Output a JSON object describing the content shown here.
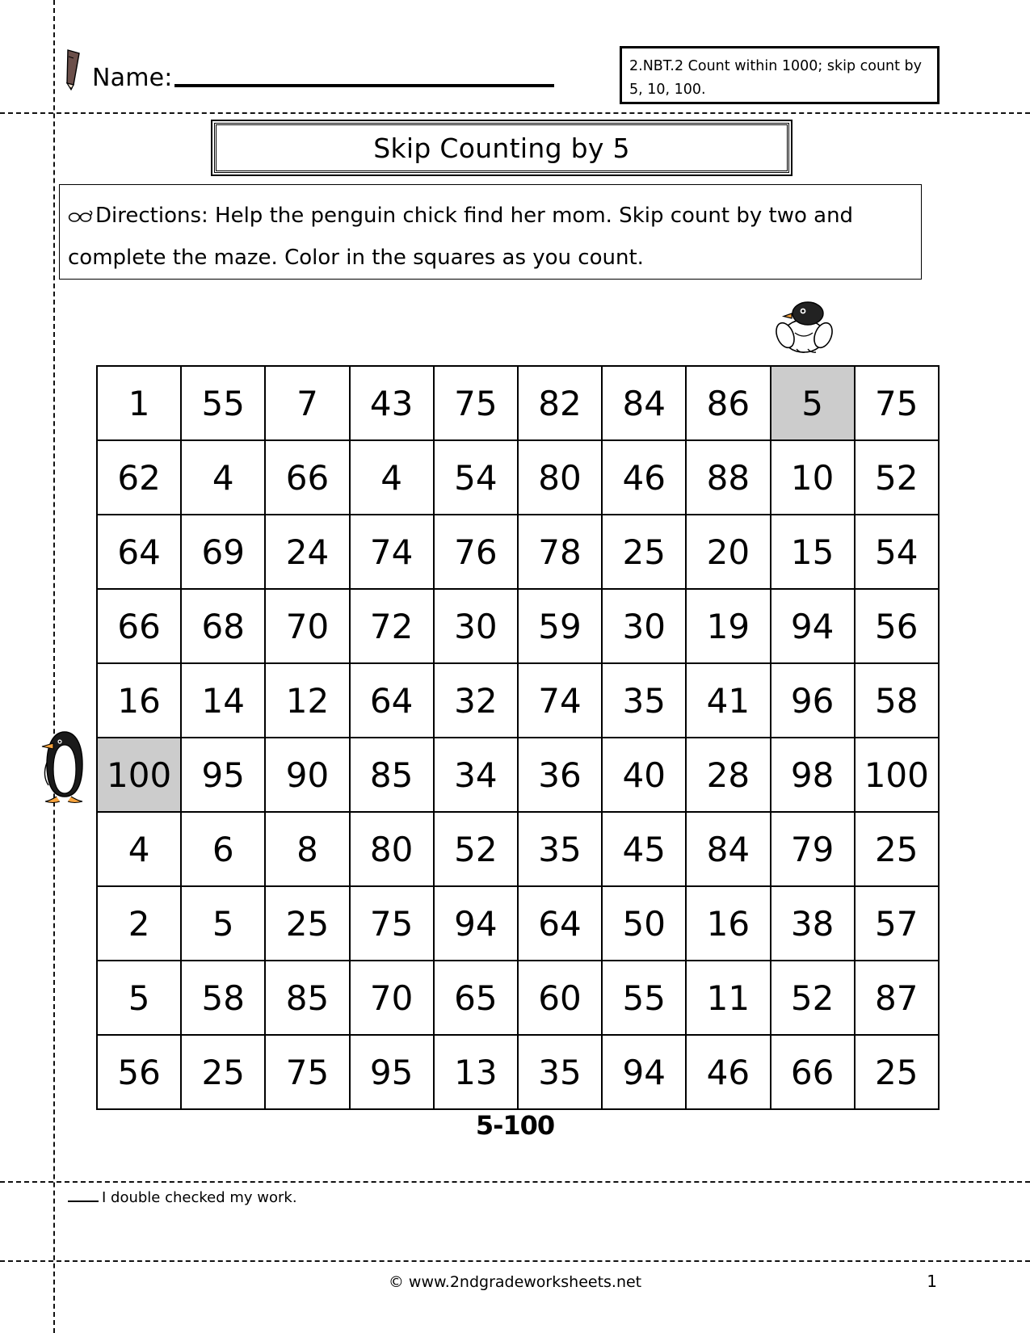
{
  "header": {
    "pencil_icon": "pencil-icon",
    "name_label": "Name:",
    "standard_line1": "2.NBT.2 Count within 1000; skip count by",
    "standard_line2": "5, 10, 100."
  },
  "title": {
    "text": "Skip Counting by 5"
  },
  "directions": {
    "glasses_icon": "glasses-icon",
    "text": "Directions:  Help the penguin chick find her mom.  Skip count by two and  complete the maze.  Color in the squares as you count."
  },
  "art": {
    "chick_icon": "penguin-chick-icon",
    "mom_icon": "penguin-mom-icon"
  },
  "maze": {
    "rows": 10,
    "cols": 10,
    "filled_color": "#cccccc",
    "cells": [
      [
        {
          "v": "1",
          "f": false
        },
        {
          "v": "55",
          "f": false
        },
        {
          "v": "7",
          "f": false
        },
        {
          "v": "43",
          "f": false
        },
        {
          "v": "75",
          "f": false
        },
        {
          "v": "82",
          "f": false
        },
        {
          "v": "84",
          "f": false
        },
        {
          "v": "86",
          "f": false
        },
        {
          "v": "5",
          "f": true
        },
        {
          "v": "75",
          "f": false
        }
      ],
      [
        {
          "v": "62",
          "f": false
        },
        {
          "v": "4",
          "f": false
        },
        {
          "v": "66",
          "f": false
        },
        {
          "v": "4",
          "f": false
        },
        {
          "v": "54",
          "f": false
        },
        {
          "v": "80",
          "f": false
        },
        {
          "v": "46",
          "f": false
        },
        {
          "v": "88",
          "f": false
        },
        {
          "v": "10",
          "f": false
        },
        {
          "v": "52",
          "f": false
        }
      ],
      [
        {
          "v": "64",
          "f": false
        },
        {
          "v": "69",
          "f": false
        },
        {
          "v": "24",
          "f": false
        },
        {
          "v": "74",
          "f": false
        },
        {
          "v": "76",
          "f": false
        },
        {
          "v": "78",
          "f": false
        },
        {
          "v": "25",
          "f": false
        },
        {
          "v": "20",
          "f": false
        },
        {
          "v": "15",
          "f": false
        },
        {
          "v": "54",
          "f": false
        }
      ],
      [
        {
          "v": "66",
          "f": false
        },
        {
          "v": "68",
          "f": false
        },
        {
          "v": "70",
          "f": false
        },
        {
          "v": "72",
          "f": false
        },
        {
          "v": "30",
          "f": false
        },
        {
          "v": "59",
          "f": false
        },
        {
          "v": "30",
          "f": false
        },
        {
          "v": "19",
          "f": false
        },
        {
          "v": "94",
          "f": false
        },
        {
          "v": "56",
          "f": false
        }
      ],
      [
        {
          "v": "16",
          "f": false
        },
        {
          "v": "14",
          "f": false
        },
        {
          "v": "12",
          "f": false
        },
        {
          "v": "64",
          "f": false
        },
        {
          "v": "32",
          "f": false
        },
        {
          "v": "74",
          "f": false
        },
        {
          "v": "35",
          "f": false
        },
        {
          "v": "41",
          "f": false
        },
        {
          "v": "96",
          "f": false
        },
        {
          "v": "58",
          "f": false
        }
      ],
      [
        {
          "v": "100",
          "f": true
        },
        {
          "v": "95",
          "f": false
        },
        {
          "v": "90",
          "f": false
        },
        {
          "v": "85",
          "f": false
        },
        {
          "v": "34",
          "f": false
        },
        {
          "v": "36",
          "f": false
        },
        {
          "v": "40",
          "f": false
        },
        {
          "v": "28",
          "f": false
        },
        {
          "v": "98",
          "f": false
        },
        {
          "v": "100",
          "f": false
        }
      ],
      [
        {
          "v": "4",
          "f": false
        },
        {
          "v": "6",
          "f": false
        },
        {
          "v": "8",
          "f": false
        },
        {
          "v": "80",
          "f": false
        },
        {
          "v": "52",
          "f": false
        },
        {
          "v": "35",
          "f": false
        },
        {
          "v": "45",
          "f": false
        },
        {
          "v": "84",
          "f": false
        },
        {
          "v": "79",
          "f": false
        },
        {
          "v": "25",
          "f": false
        }
      ],
      [
        {
          "v": "2",
          "f": false
        },
        {
          "v": "5",
          "f": false
        },
        {
          "v": "25",
          "f": false
        },
        {
          "v": "75",
          "f": false
        },
        {
          "v": "94",
          "f": false
        },
        {
          "v": "64",
          "f": false
        },
        {
          "v": "50",
          "f": false
        },
        {
          "v": "16",
          "f": false
        },
        {
          "v": "38",
          "f": false
        },
        {
          "v": "57",
          "f": false
        }
      ],
      [
        {
          "v": "5",
          "f": false
        },
        {
          "v": "58",
          "f": false
        },
        {
          "v": "85",
          "f": false
        },
        {
          "v": "70",
          "f": false
        },
        {
          "v": "65",
          "f": false
        },
        {
          "v": "60",
          "f": false
        },
        {
          "v": "55",
          "f": false
        },
        {
          "v": "11",
          "f": false
        },
        {
          "v": "52",
          "f": false
        },
        {
          "v": "87",
          "f": false
        }
      ],
      [
        {
          "v": "56",
          "f": false
        },
        {
          "v": "25",
          "f": false
        },
        {
          "v": "75",
          "f": false
        },
        {
          "v": "95",
          "f": false
        },
        {
          "v": "13",
          "f": false
        },
        {
          "v": "35",
          "f": false
        },
        {
          "v": "94",
          "f": false
        },
        {
          "v": "46",
          "f": false
        },
        {
          "v": "66",
          "f": false
        },
        {
          "v": "25",
          "f": false
        }
      ]
    ]
  },
  "range_caption": "5-100",
  "double_check": "I double checked my work.",
  "footer": {
    "credit": "© www.2ndgradeworksheets.net",
    "page_number": "1"
  }
}
